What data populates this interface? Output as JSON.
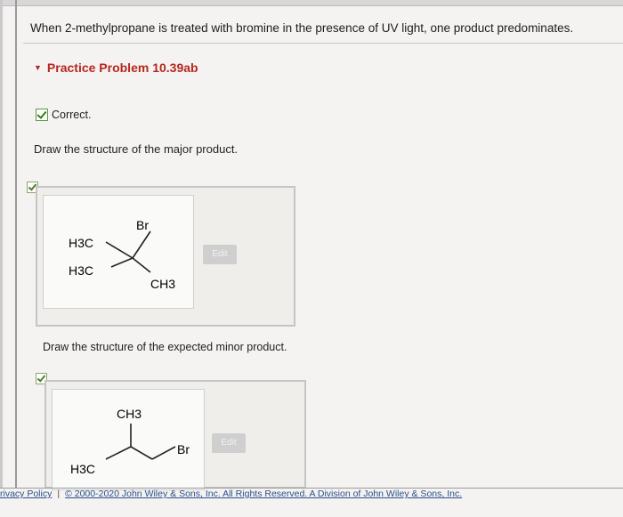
{
  "question": "When 2-methylpropane is treated with bromine in the presence of UV light, one product predominates.",
  "practice_title": "Practice Problem 10.39ab",
  "status": "Correct.",
  "part_a": {
    "prompt": "Draw the structure of the major product.",
    "edit_label": "Edit",
    "labels": {
      "top_left": "H3C",
      "bottom_left": "H3C",
      "top": "Br",
      "right": "CH3"
    }
  },
  "part_b": {
    "prompt": "Draw the structure of the expected minor product.",
    "edit_label": "Edit",
    "labels": {
      "top": "CH3",
      "left": "H3C",
      "right": "Br"
    }
  },
  "footer": {
    "privacy": "rivacy Policy",
    "separator": "|",
    "copyright": "© 2000-2020 John Wiley & Sons, Inc. All Rights Reserved. A Division of John Wiley & Sons, Inc."
  }
}
